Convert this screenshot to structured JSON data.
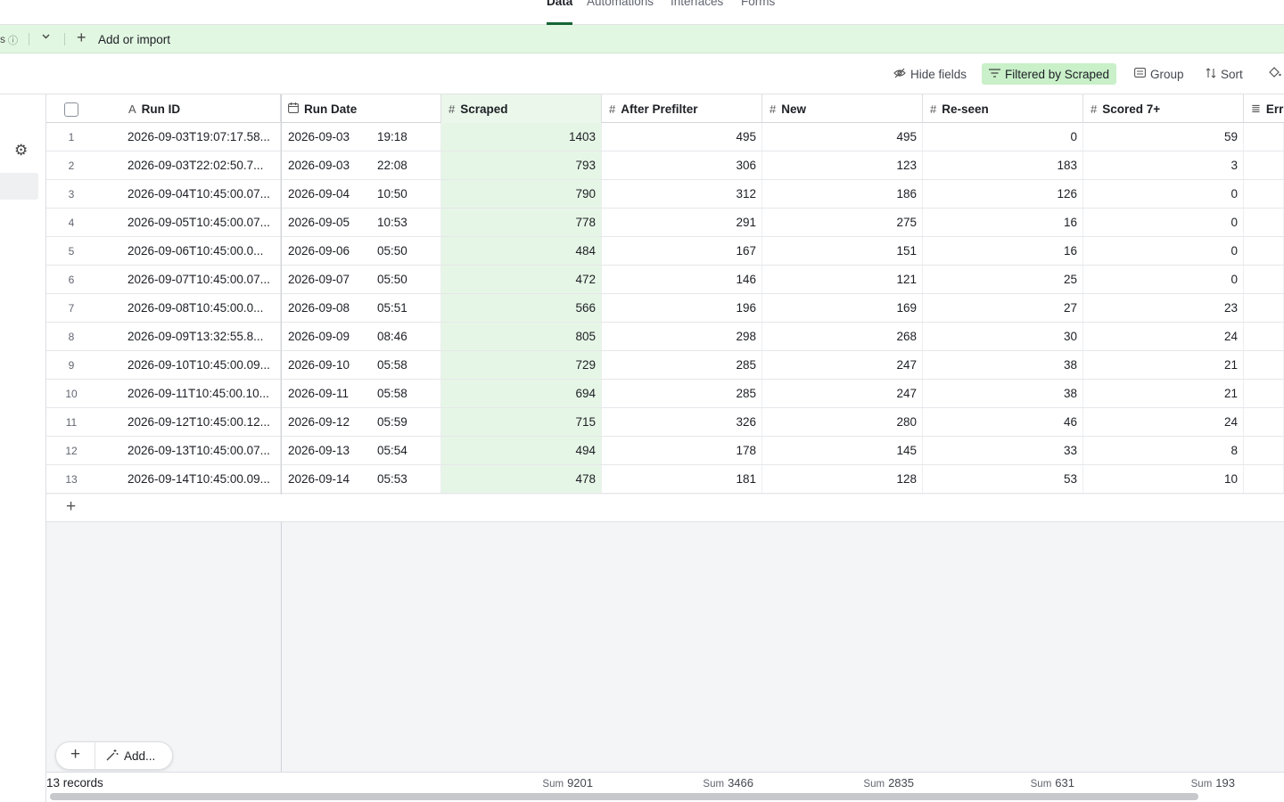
{
  "nav": {
    "tabs": [
      "Data",
      "Automations",
      "Interfaces",
      "Forms"
    ],
    "active": "Data"
  },
  "tablebar": {
    "fragment": "s",
    "add_import": "Add or import"
  },
  "toolbar": {
    "hide_fields": "Hide fields",
    "filter": "Filtered by Scraped",
    "group": "Group",
    "sort": "Sort"
  },
  "columns": [
    "Run ID",
    "Run Date",
    "Scraped",
    "After Prefilter",
    "New",
    "Re-seen",
    "Scored 7+",
    "Err"
  ],
  "rows": [
    {
      "n": "1",
      "id": "2026-09-03T19:07:17.58...",
      "date": "2026-09-03",
      "time": "19:18",
      "scraped": "1403",
      "prefilter": "495",
      "new": "495",
      "reseen": "0",
      "scored": "59"
    },
    {
      "n": "2",
      "id": "2026-09-03T22:02:50.7...",
      "date": "2026-09-03",
      "time": "22:08",
      "scraped": "793",
      "prefilter": "306",
      "new": "123",
      "reseen": "183",
      "scored": "3"
    },
    {
      "n": "3",
      "id": "2026-09-04T10:45:00.07...",
      "date": "2026-09-04",
      "time": "10:50",
      "scraped": "790",
      "prefilter": "312",
      "new": "186",
      "reseen": "126",
      "scored": "0"
    },
    {
      "n": "4",
      "id": "2026-09-05T10:45:00.07...",
      "date": "2026-09-05",
      "time": "10:53",
      "scraped": "778",
      "prefilter": "291",
      "new": "275",
      "reseen": "16",
      "scored": "0"
    },
    {
      "n": "5",
      "id": "2026-09-06T10:45:00.0...",
      "date": "2026-09-06",
      "time": "05:50",
      "scraped": "484",
      "prefilter": "167",
      "new": "151",
      "reseen": "16",
      "scored": "0"
    },
    {
      "n": "6",
      "id": "2026-09-07T10:45:00.07...",
      "date": "2026-09-07",
      "time": "05:50",
      "scraped": "472",
      "prefilter": "146",
      "new": "121",
      "reseen": "25",
      "scored": "0"
    },
    {
      "n": "7",
      "id": "2026-09-08T10:45:00.0...",
      "date": "2026-09-08",
      "time": "05:51",
      "scraped": "566",
      "prefilter": "196",
      "new": "169",
      "reseen": "27",
      "scored": "23"
    },
    {
      "n": "8",
      "id": "2026-09-09T13:32:55.8...",
      "date": "2026-09-09",
      "time": "08:46",
      "scraped": "805",
      "prefilter": "298",
      "new": "268",
      "reseen": "30",
      "scored": "24"
    },
    {
      "n": "9",
      "id": "2026-09-10T10:45:00.09...",
      "date": "2026-09-10",
      "time": "05:58",
      "scraped": "729",
      "prefilter": "285",
      "new": "247",
      "reseen": "38",
      "scored": "21"
    },
    {
      "n": "10",
      "id": "2026-09-11T10:45:00.10...",
      "date": "2026-09-11",
      "time": "05:58",
      "scraped": "694",
      "prefilter": "285",
      "new": "247",
      "reseen": "38",
      "scored": "21"
    },
    {
      "n": "11",
      "id": "2026-09-12T10:45:00.12...",
      "date": "2026-09-12",
      "time": "05:59",
      "scraped": "715",
      "prefilter": "326",
      "new": "280",
      "reseen": "46",
      "scored": "24"
    },
    {
      "n": "12",
      "id": "2026-09-13T10:45:00.07...",
      "date": "2026-09-13",
      "time": "05:54",
      "scraped": "494",
      "prefilter": "178",
      "new": "145",
      "reseen": "33",
      "scored": "8"
    },
    {
      "n": "13",
      "id": "2026-09-14T10:45:00.09...",
      "date": "2026-09-14",
      "time": "05:53",
      "scraped": "478",
      "prefilter": "181",
      "new": "128",
      "reseen": "53",
      "scored": "10"
    }
  ],
  "fab": {
    "add_label": "Add..."
  },
  "footer": {
    "records": "13 records",
    "sum_key": "Sum",
    "sums": {
      "scraped": "9201",
      "prefilter": "3466",
      "new": "2835",
      "reseen": "631",
      "scored": "193"
    }
  }
}
